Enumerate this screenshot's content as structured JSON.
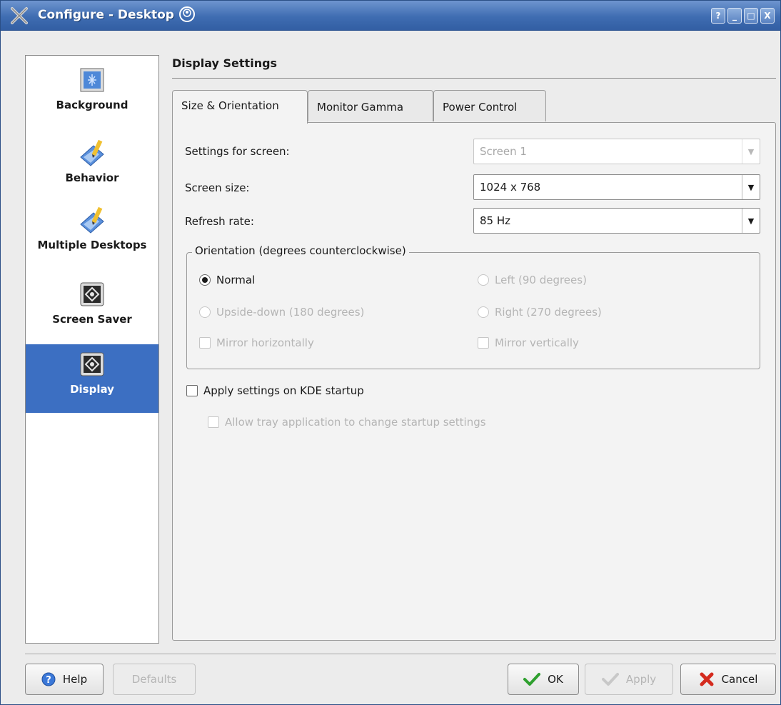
{
  "window": {
    "title": "Configure - Desktop",
    "buttons": [
      "?",
      "_",
      "□",
      "X"
    ]
  },
  "sidebar": {
    "items": [
      {
        "label": "Background",
        "icon": "background-icon",
        "selected": false
      },
      {
        "label": "Behavior",
        "icon": "behavior-icon",
        "selected": false
      },
      {
        "label": "Multiple Desktops",
        "icon": "multiple-desktops-icon",
        "selected": false
      },
      {
        "label": "Screen Saver",
        "icon": "screen-saver-icon",
        "selected": false
      },
      {
        "label": "Display",
        "icon": "display-icon",
        "selected": true
      }
    ]
  },
  "main": {
    "header": "Display Settings",
    "tabs": [
      {
        "label": "Size & Orientation",
        "active": true
      },
      {
        "label": "Monitor Gamma",
        "active": false
      },
      {
        "label": "Power Control",
        "active": false
      }
    ],
    "settings_for_screen": {
      "label": "Settings for screen:",
      "value": "Screen 1",
      "enabled": false
    },
    "screen_size": {
      "label": "Screen size:",
      "value": "1024 x 768",
      "enabled": true
    },
    "refresh_rate": {
      "label": "Refresh rate:",
      "value": "85 Hz",
      "enabled": true
    },
    "orientation": {
      "title": "Orientation (degrees counterclockwise)",
      "normal": {
        "label": "Normal",
        "checked": true,
        "enabled": true
      },
      "left": {
        "label": "Left (90 degrees)",
        "checked": false,
        "enabled": false
      },
      "upside_down": {
        "label": "Upside-down (180 degrees)",
        "checked": false,
        "enabled": false
      },
      "right": {
        "label": "Right (270 degrees)",
        "checked": false,
        "enabled": false
      },
      "mirror_h": {
        "label": "Mirror horizontally",
        "checked": false,
        "enabled": false
      },
      "mirror_v": {
        "label": "Mirror vertically",
        "checked": false,
        "enabled": false
      }
    },
    "apply_startup": {
      "label": "Apply settings on KDE startup",
      "checked": false,
      "enabled": true
    },
    "allow_tray": {
      "label": "Allow tray application to change startup settings",
      "checked": false,
      "enabled": false
    }
  },
  "footer": {
    "help": "Help",
    "defaults": "Defaults",
    "ok": "OK",
    "apply": "Apply",
    "cancel": "Cancel"
  },
  "colors": {
    "titlebar": "#3f6db2",
    "selection": "#3c6fc2",
    "disabled_text": "#b5b5b5"
  }
}
